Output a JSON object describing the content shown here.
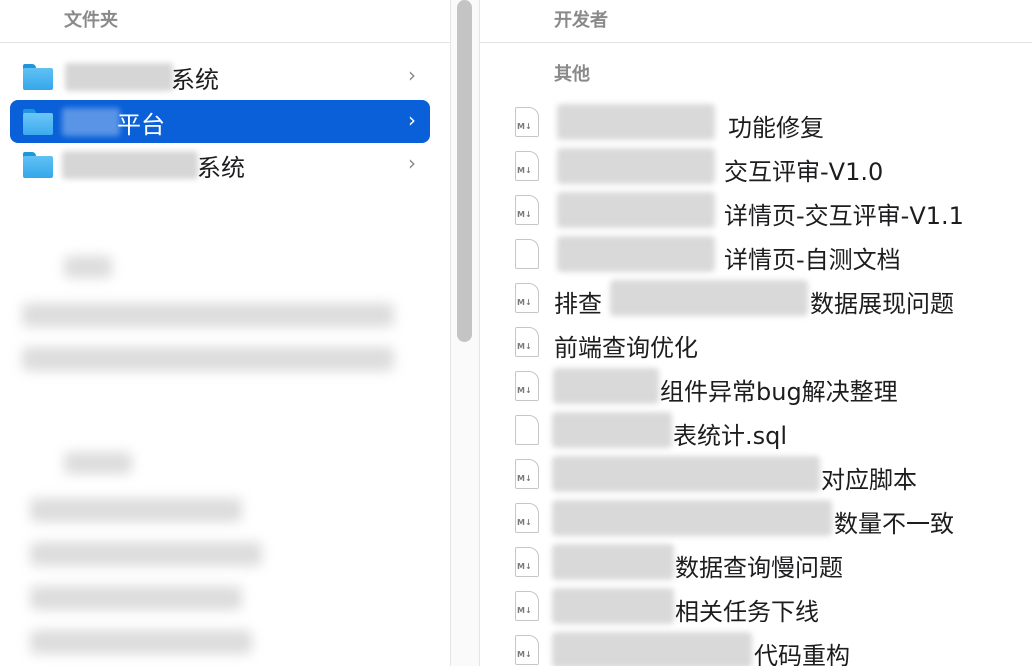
{
  "left": {
    "header": "文件夹",
    "folders": [
      {
        "label": "系统",
        "selected": false
      },
      {
        "label": "平台",
        "selected": true
      },
      {
        "label": "系统",
        "selected": false
      }
    ]
  },
  "right": {
    "header": "开发者",
    "section": "其他",
    "files": [
      {
        "label": "功能修复",
        "icon": "markdown-file-icon"
      },
      {
        "label": "交互评审-V1.0",
        "icon": "markdown-file-icon"
      },
      {
        "label": "详情页-交互评审-V1.1",
        "icon": "markdown-file-icon"
      },
      {
        "label": "详情页-自测文档",
        "icon": "blank-file-icon"
      },
      {
        "label": "排查",
        "label2": "数据展现问题",
        "icon": "markdown-file-icon"
      },
      {
        "label": "前端查询优化",
        "icon": "markdown-file-icon"
      },
      {
        "label": "组件异常bug解决整理",
        "icon": "markdown-file-icon"
      },
      {
        "label": "表统计.sql",
        "icon": "blank-file-icon"
      },
      {
        "label": "对应脚本",
        "icon": "markdown-file-icon"
      },
      {
        "label": "数量不一致",
        "icon": "markdown-file-icon"
      },
      {
        "label": "数据查询慢问题",
        "icon": "markdown-file-icon"
      },
      {
        "label": "相关任务下线",
        "icon": "markdown-file-icon"
      },
      {
        "label": "代码重构",
        "icon": "markdown-file-icon"
      }
    ]
  },
  "icons": {
    "md_mark": "M↓",
    "chevron": "›"
  },
  "colors": {
    "selection": "#0a60d8",
    "folder": "#3aa9ec"
  }
}
